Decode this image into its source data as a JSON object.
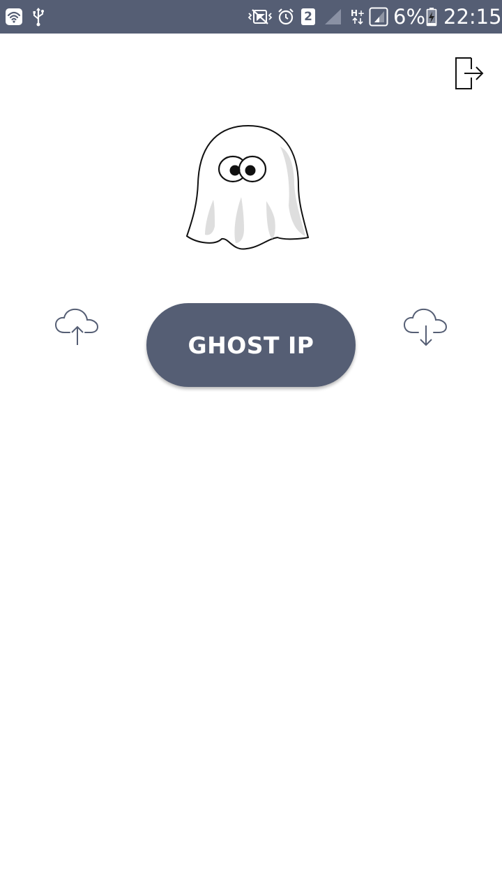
{
  "status_bar": {
    "sim_slot": "2",
    "network_type": "H+",
    "battery_percent": "6%",
    "time": "22:15",
    "icons": [
      "wifi-icon",
      "usb-icon",
      "vibrate-icon",
      "alarm-icon",
      "sim-badge",
      "signal-empty-icon",
      "data-arrows-icon",
      "signal-icon",
      "battery-charging-icon"
    ]
  },
  "header": {
    "exit_icon": "exit-icon"
  },
  "main": {
    "ghost_image": "ghost-illustration",
    "upload_icon": "cloud-upload-icon",
    "download_icon": "cloud-download-icon",
    "ghost_button_label": "GHOST IP"
  },
  "colors": {
    "primary": "#555e74",
    "background": "#ffffff",
    "ghost_shade": "#dedede"
  }
}
